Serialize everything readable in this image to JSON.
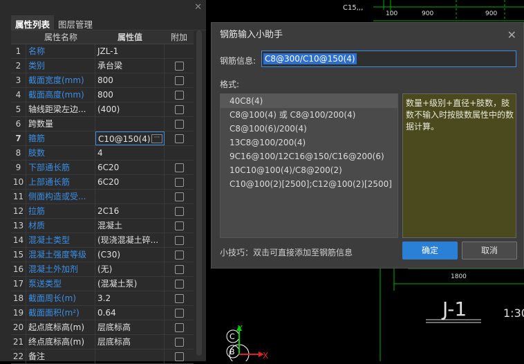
{
  "panel": {
    "tabs": [
      "属性列表",
      "图层管理"
    ],
    "headers": [
      "",
      "属性名称",
      "属性值",
      "附加"
    ],
    "rows": [
      {
        "n": "1",
        "name": "名称",
        "value": "JZL-1"
      },
      {
        "n": "2",
        "name": "类别",
        "value": "承台梁"
      },
      {
        "n": "3",
        "name": "截面宽度(mm)",
        "value": "800"
      },
      {
        "n": "4",
        "name": "截面高度(mm)",
        "value": "800"
      },
      {
        "n": "5",
        "name": "轴线距梁左边...",
        "value": "(400)"
      },
      {
        "n": "6",
        "name": "跨数量",
        "value": ""
      },
      {
        "n": "7",
        "name": "箍筋",
        "value": "C10@150(4)"
      },
      {
        "n": "8",
        "name": "肢数",
        "value": "4"
      },
      {
        "n": "9",
        "name": "下部通长筋",
        "value": "6C20"
      },
      {
        "n": "10",
        "name": "上部通长筋",
        "value": "6C20"
      },
      {
        "n": "11",
        "name": "侧面构造或受...",
        "value": ""
      },
      {
        "n": "12",
        "name": "拉筋",
        "value": "2C16"
      },
      {
        "n": "13",
        "name": "材质",
        "value": "混凝土"
      },
      {
        "n": "14",
        "name": "混凝土类型",
        "value": "(现浇混凝土碎..."
      },
      {
        "n": "15",
        "name": "混凝土强度等级",
        "value": "(C30)"
      },
      {
        "n": "16",
        "name": "混凝土外加剂",
        "value": "(无)"
      },
      {
        "n": "17",
        "name": "泵送类型",
        "value": "(混凝土泵)"
      },
      {
        "n": "18",
        "name": "截面周长(m)",
        "value": "3.2"
      },
      {
        "n": "19",
        "name": "截面面积(m²)",
        "value": "0.64"
      },
      {
        "n": "20",
        "name": "起点底标高(m)",
        "value": "层底标高"
      },
      {
        "n": "21",
        "name": "终点底标高(m)",
        "value": "层底标高"
      },
      {
        "n": "22",
        "name": "备注",
        "value": ""
      }
    ]
  },
  "dialog": {
    "title": "钢筋输入小助手",
    "info_label": "钢筋信息:",
    "info_value": "C8@300/C10@150(4)",
    "format_label": "格式:",
    "formats": [
      "40C8(4)",
      "C8@100(4) 或 C8@100/200(4)",
      "C8@100(6)/200(4)",
      "13C8@100/200(4)",
      "9C16@100/12C16@150/C16@200(6)",
      "10C10@100(4)/C8@200(2)",
      "C10@100(2)[2500];C12@100(2)[2500]"
    ],
    "description": "数量+级别+直径+肢数，肢数不输入时按肢数属性中的数据计算。",
    "tip": "小技巧：双击可直接添加至钢筋信息",
    "ok": "确定",
    "cancel": "取消"
  },
  "cad": {
    "label_c15": "C15,,,",
    "dims_top": [
      "100",
      "900",
      "900"
    ],
    "dim_1800": "1800",
    "title": "J-1",
    "scale": "1:30",
    "axis_y": "Y",
    "axis_x": "X",
    "axis_c": "C",
    "axis_b": "B"
  },
  "colors": {
    "accent": "#2a7fd6",
    "blue_text": "#3b8fe6",
    "cad_green": "#00c000"
  }
}
